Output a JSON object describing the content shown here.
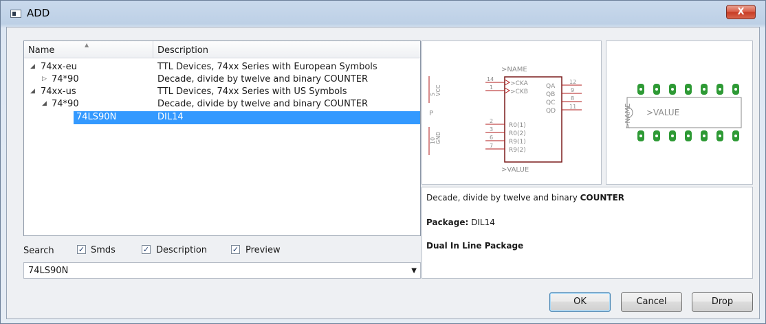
{
  "window": {
    "title": "ADD",
    "close_glyph": "X"
  },
  "tree": {
    "columns": {
      "name": "Name",
      "description": "Description"
    },
    "rows": [
      {
        "name": "74xx-eu",
        "desc": "TTL Devices, 74xx Series with European Symbols",
        "expander": "◢"
      },
      {
        "name": "74*90",
        "desc": "Decade, divide by twelve and binary COUNTER",
        "expander": "▷"
      },
      {
        "name": "74xx-us",
        "desc": "TTL Devices, 74xx Series with US Symbols",
        "expander": "◢"
      },
      {
        "name": "74*90",
        "desc": "Decade, divide by twelve and binary COUNTER",
        "expander": "◢"
      },
      {
        "name": "74LS90N",
        "desc": "DIL14"
      }
    ]
  },
  "search": {
    "label": "Search",
    "smds_label": "Smds",
    "description_label": "Description",
    "preview_label": "Preview",
    "check_glyph": "✓",
    "value": "74LS90N",
    "dropdown_arrow": "▼"
  },
  "symbol": {
    "name": ">NAME",
    "value": ">VALUE",
    "vcc": "VCC",
    "gnd": "GND",
    "p": "P",
    "vcc_pin": "5",
    "gnd_pin": "10",
    "left_pins": [
      "14",
      "1",
      "2",
      "3",
      "6",
      "7"
    ],
    "left_labels": [
      ">CKA",
      ">CKB",
      "R0(1)",
      "R0(2)",
      "R9(1)",
      "R9(2)"
    ],
    "right_pins": [
      "12",
      "9",
      "8",
      "11"
    ],
    "right_labels": [
      "QA",
      "QB",
      "QC",
      "QD"
    ]
  },
  "package": {
    "name": ">NAME",
    "value": ">VALUE"
  },
  "details": {
    "line1_prefix": "Decade, divide by twelve and binary ",
    "line1_bold": "COUNTER",
    "package_label": "Package:",
    "package_value": "DIL14",
    "package_desc": "Dual In Line Package"
  },
  "buttons": {
    "ok": "OK",
    "cancel": "Cancel",
    "drop": "Drop"
  }
}
